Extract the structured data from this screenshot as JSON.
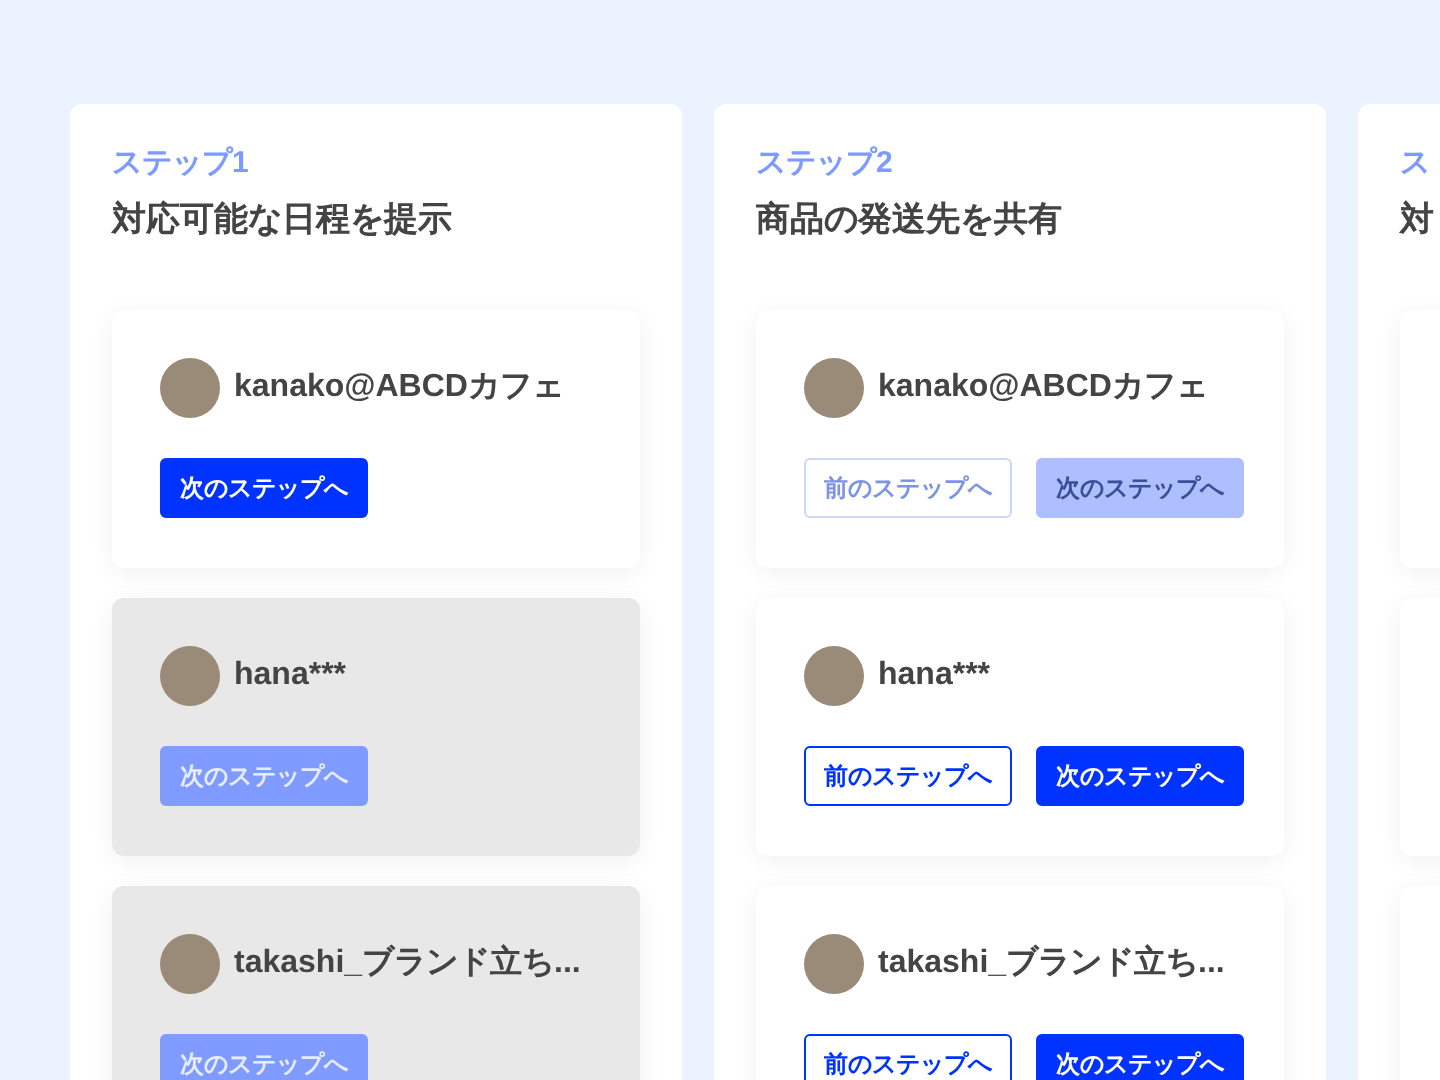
{
  "columns": [
    {
      "step": "ステップ1",
      "title": "対応可能な日程を提示",
      "cards": [
        {
          "name": "kanako@ABCDカフェ",
          "greyed": false,
          "buttons": [
            {
              "label": "次のステップへ",
              "kind": "next",
              "disabled": false
            }
          ]
        },
        {
          "name": "hana***",
          "greyed": true,
          "buttons": [
            {
              "label": "次のステップへ",
              "kind": "next",
              "disabled": true
            }
          ]
        },
        {
          "name": "takashi_ブランド立ち...",
          "greyed": true,
          "buttons": [
            {
              "label": "次のステップへ",
              "kind": "next",
              "disabled": true
            }
          ]
        }
      ]
    },
    {
      "step": "ステップ2",
      "title": "商品の発送先を共有",
      "cards": [
        {
          "name": "kanako@ABCDカフェ",
          "greyed": false,
          "buttons": [
            {
              "label": "前のステップへ",
              "kind": "prev",
              "disabled": true
            },
            {
              "label": "次のステップへ",
              "kind": "next",
              "disabled": true
            }
          ]
        },
        {
          "name": "hana***",
          "greyed": false,
          "buttons": [
            {
              "label": "前のステップへ",
              "kind": "prev",
              "disabled": false
            },
            {
              "label": "次のステップへ",
              "kind": "next",
              "disabled": false
            }
          ]
        },
        {
          "name": "takashi_ブランド立ち...",
          "greyed": false,
          "buttons": [
            {
              "label": "前のステップへ",
              "kind": "prev",
              "disabled": false
            },
            {
              "label": "次のステップへ",
              "kind": "next",
              "disabled": false
            }
          ]
        }
      ]
    },
    {
      "step": "ス",
      "title": "対",
      "cards": [
        {
          "greyed": false
        },
        {
          "greyed": false
        },
        {
          "greyed": false
        }
      ]
    }
  ]
}
